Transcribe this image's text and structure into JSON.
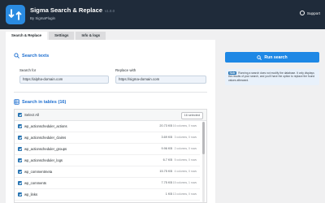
{
  "header": {
    "title": "Sigma Search & Replace",
    "version": "v1.0.0",
    "byline": "By SigmaPlugin",
    "support": "Support"
  },
  "tabs": [
    {
      "label": "Search & Replace",
      "active": true
    },
    {
      "label": "Settings",
      "active": false
    },
    {
      "label": "Info & logs",
      "active": false
    }
  ],
  "search": {
    "section_title": "Search texts",
    "search_label": "Search for",
    "search_value": "https://alpha-domain.com",
    "replace_label": "Replace with",
    "replace_value": "https://sigma-domain.com"
  },
  "tables": {
    "section_title": "Search in tables (16)",
    "select_all": "Select All",
    "selected_badge": "16 selected",
    "rows": [
      {
        "name": "wp_actionscheduler_actions",
        "size": "20.73 KB",
        "info": "16 columns, 0 rows"
      },
      {
        "name": "wp_actionscheduler_claims",
        "size": "3.69 KB",
        "info": "3 columns, 0 rows"
      },
      {
        "name": "wp_actionscheduler_groups",
        "size": "9.96 KB",
        "info": "2 columns, 0 rows"
      },
      {
        "name": "wp_actionscheduler_logs",
        "size": "6.7 KB",
        "info": "5 columns, 0 rows"
      },
      {
        "name": "wp_commentmeta",
        "size": "15.75 KB",
        "info": "4 columns, 0 rows"
      },
      {
        "name": "wp_comments",
        "size": "7.75 KB",
        "info": "15 columns, 1 rows"
      },
      {
        "name": "wp_links",
        "size": "1 KB",
        "info": "13 columns, 0 rows"
      }
    ]
  },
  "actions": {
    "run_label": "Run search",
    "note_tag": "Note",
    "note_text": "Running a search does not modify the database. It only displays the results of your search, and you'll have the option to replace the found values afterward."
  }
}
